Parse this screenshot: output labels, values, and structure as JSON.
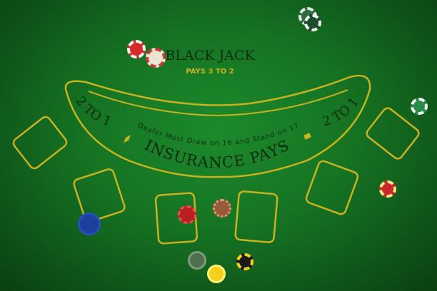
{
  "table": {
    "title": "BLACK JACK",
    "subtitle": "PAYS 3 TO 2",
    "rule_text": "Dealer Must Draw on 16 and Stand on 17",
    "insurance_text": "INSURANCE PAYS",
    "left_odds": "2 TO 1",
    "right_odds": "2 TO 1"
  },
  "colors": {
    "felt": "#157222",
    "gold": "#c9b21f",
    "text_dark": "#0b2a0e"
  },
  "chips": [
    {
      "name": "chip-red-stack",
      "color": "#d42a2a"
    },
    {
      "name": "chip-white",
      "color": "#e8e2d4"
    },
    {
      "name": "chip-green-stack",
      "color": "#1f5b33"
    },
    {
      "name": "chip-green-right",
      "color": "#2a8a4a"
    },
    {
      "name": "chip-red-right",
      "color": "#c8282a"
    },
    {
      "name": "chip-blue",
      "color": "#1d3f9c"
    },
    {
      "name": "chip-red-center",
      "color": "#b8201e"
    },
    {
      "name": "chip-brown",
      "color": "#9a5a3a"
    },
    {
      "name": "chip-grey",
      "color": "#4f6f4f"
    },
    {
      "name": "chip-black-yellow",
      "color": "#1a1a1a"
    },
    {
      "name": "chip-yellow",
      "color": "#f2d21a"
    }
  ]
}
